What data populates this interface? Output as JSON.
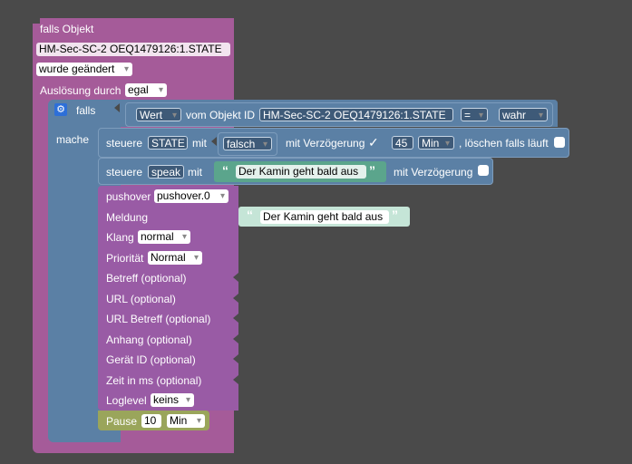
{
  "trigger": {
    "header": "falls Objekt",
    "object_id": "HM-Sec-SC-2 OEQ1479126:1.STATE",
    "condition": "wurde geändert",
    "trigger_label": "Auslösung durch",
    "trigger_value": "egal"
  },
  "if_block": {
    "falls_label": "falls",
    "mache_label": "mache",
    "compare": {
      "value_select": "Wert",
      "of_object_label": "vom Objekt ID",
      "object_id": "HM-Sec-SC-2 OEQ1479126:1.STATE",
      "operator": "=",
      "compare_value": "wahr"
    },
    "control1": {
      "label": "steuere",
      "target": "STATE",
      "with_label": "mit",
      "value": "falsch",
      "delay_label": "mit Verzögerung",
      "delay_checkmark": "✓",
      "delay_value": "45",
      "delay_unit": "Min",
      "clear_label": ", löschen falls läuft"
    },
    "control2": {
      "label": "steuere",
      "target": "speak",
      "with_label": "mit",
      "text": "Der Kamin geht bald aus",
      "delay_label": "mit Verzögerung"
    },
    "pushover": {
      "label": "pushover",
      "instance": "pushover.0",
      "message_label": "Meldung",
      "message_text": "Der Kamin geht bald aus",
      "sound_label": "Klang",
      "sound_value": "normal",
      "priority_label": "Priorität",
      "priority_value": "Normal",
      "fields": [
        "Betreff (optional)",
        "URL (optional)",
        "URL Betreff (optional)",
        "Anhang (optional)",
        "Gerät ID (optional)",
        "Zeit in ms (optional)"
      ],
      "loglevel_label": "Loglevel",
      "loglevel_value": "keins"
    },
    "pause": {
      "label": "Pause",
      "value": "10",
      "unit": "Min"
    }
  },
  "colors": {
    "background": "#4a4a4a",
    "trigger": "#a55b99",
    "logic": "#5b80a5",
    "pushover": "#995ba5",
    "text": "#5ba58c",
    "pause": "#9aa55b"
  }
}
